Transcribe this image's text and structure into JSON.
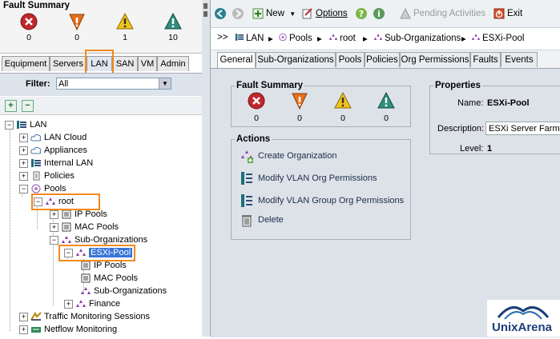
{
  "fault_summary": {
    "title": "Fault Summary",
    "counts": [
      "0",
      "0",
      "1",
      "10"
    ]
  },
  "left_tabs": [
    "Equipment",
    "Servers",
    "LAN",
    "SAN",
    "VM",
    "Admin"
  ],
  "filter": {
    "label": "Filter:",
    "value": "All"
  },
  "tree": {
    "root": "LAN",
    "lan_cloud": "LAN Cloud",
    "appliances": "Appliances",
    "internal_lan": "Internal LAN",
    "policies": "Policies",
    "pools": "Pools",
    "root_org": "root",
    "ip_pools": "IP Pools",
    "mac_pools": "MAC Pools",
    "sub_orgs": "Sub-Organizations",
    "esxi_pool": "ESXi-Pool",
    "esxi_ip_pools": "IP Pools",
    "esxi_mac_pools": "MAC Pools",
    "esxi_sub_orgs": "Sub-Organizations",
    "finance": "Finance",
    "traffic": "Traffic Monitoring Sessions",
    "netflow": "Netflow Monitoring"
  },
  "toolbar": {
    "new": "New",
    "options": "Options",
    "pending": "Pending Activities",
    "exit": "Exit"
  },
  "breadcrumb": {
    "prefix": ">>",
    "items": [
      "LAN",
      "Pools",
      "root",
      "Sub-Organizations",
      "ESXi-Pool"
    ]
  },
  "right_tabs": [
    "General",
    "Sub-Organizations",
    "Pools",
    "Policies",
    "Org Permissions",
    "Faults",
    "Events"
  ],
  "general": {
    "fault_title": "Fault Summary",
    "fault_counts": [
      "0",
      "0",
      "0",
      "0"
    ],
    "actions_title": "Actions",
    "actions": [
      "Create Organization",
      "Modify VLAN Org Permissions",
      "Modify VLAN Group Org Permissions",
      "Delete"
    ],
    "properties_title": "Properties",
    "name_label": "Name:",
    "name_value": "ESXi-Pool",
    "desc_label": "Description:",
    "desc_value": "ESXi Server Farm",
    "level_label": "Level:",
    "level_value": "1"
  },
  "logo_text": "UnixArena",
  "colors": {
    "critical": "#c0272d",
    "major": "#e8711c",
    "minor": "#f2c319",
    "warning": "#2f8f7f",
    "highlight": "#f28a1c",
    "selection": "#3875d7"
  }
}
